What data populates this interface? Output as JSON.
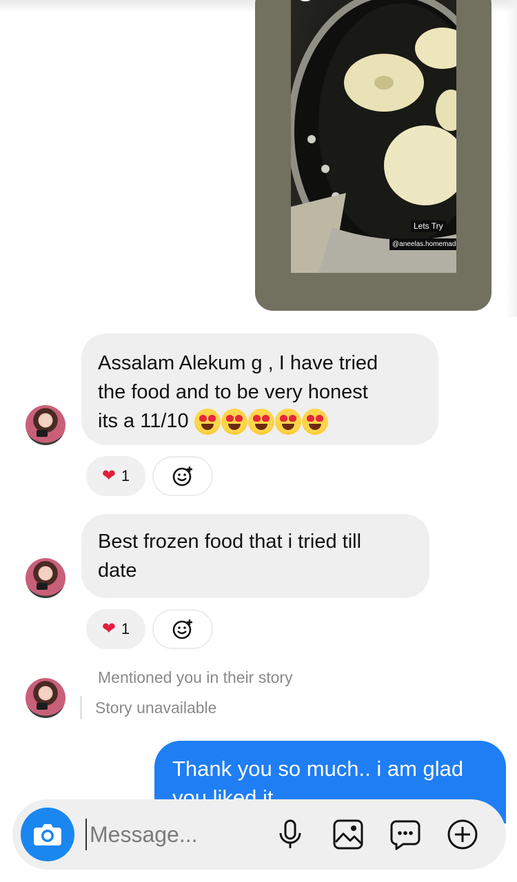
{
  "story_card": {
    "tag_title": "Lets Try",
    "tag_handle": "@aneelas.homemadefood"
  },
  "messages": [
    {
      "text": "Assalam Alekum g , I have tried the food and to be very honest its a 11/10",
      "line1": "Assalam Alekum g , I have tried",
      "line2": "the food and to be very honest",
      "line3": "its a 11/10",
      "emoji": [
        "heart-eyes",
        "heart-eyes",
        "heart-eyes",
        "heart-eyes",
        "heart-eyes"
      ],
      "reaction_count": "1"
    },
    {
      "text": "Best frozen food that i tried till date",
      "line1": "Best frozen food that i tried till",
      "line2": "date",
      "reaction_count": "1"
    }
  ],
  "mention": {
    "text": "Mentioned you in their story",
    "story_status": "Story unavailable"
  },
  "outgoing": {
    "text": "Thank you so much.. i am glad you liked it",
    "line1": "Thank you so much.. i am glad",
    "line2": "you liked it"
  },
  "composer": {
    "placeholder": "Message...",
    "icons": [
      "camera-icon",
      "microphone-icon",
      "gallery-icon",
      "sticker-icon",
      "plus-circle-icon"
    ]
  },
  "colors": {
    "outgoing_bubble": "#1f7ef3",
    "incoming_bubble": "#efefef",
    "heart": "#e41e3f",
    "camera_button": "#1a86f0"
  }
}
